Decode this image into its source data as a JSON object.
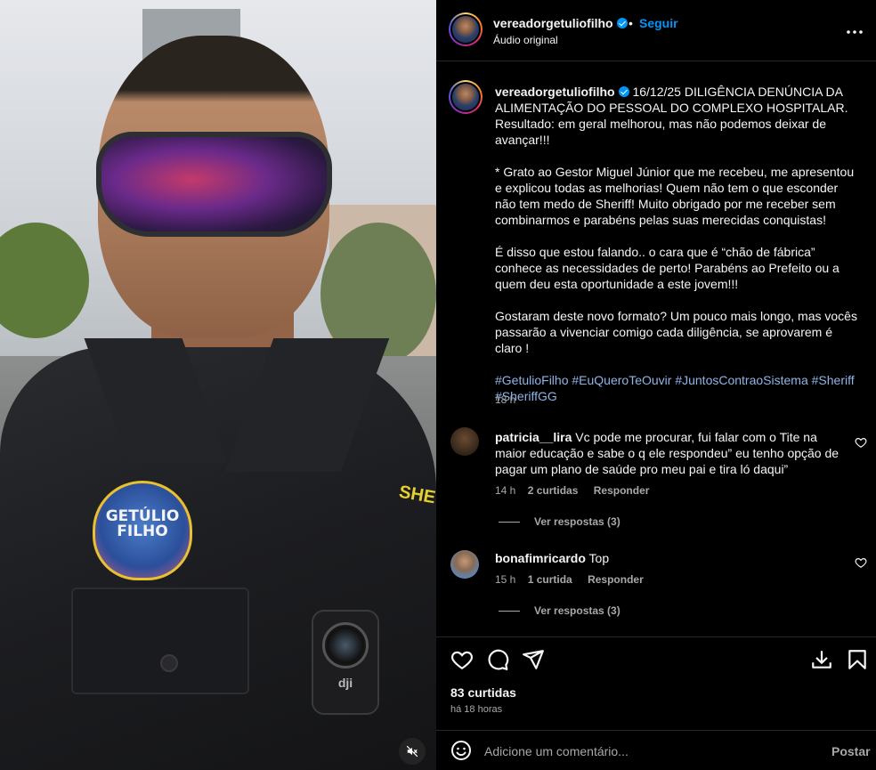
{
  "post": {
    "username": "vereadorgetuliofilho",
    "separator": "•",
    "follow_label": "Seguir",
    "audio_label": "Áudio original",
    "caption_username": "vereadorgetuliofilho",
    "caption_text": " 16/12/25 DILIGÊNCIA DENÚNCIA DA ALIMENTAÇÃO DO PESSOAL DO COMPLEXO HOSPITALAR.\nResultado: em geral melhorou, mas não podemos deixar de avançar!!!\n\n* Grato ao Gestor Miguel Júnior que me recebeu, me apresentou e explicou todas as melhorias! Quem não tem o que esconder não tem medo de Sheriff! Muito obrigado por me receber sem combinarmos e parabéns pelas suas merecidas conquistas!\n\nÉ disso que estou falando.. o cara que é “chão de fábrica” conhece as necessidades de perto! Parabéns ao Prefeito ou a quem deu esta oportunidade a este jovem!!!\n\nGostaram deste novo formato? Um pouco mais longo, mas vocês passarão a vivenciar comigo cada diligência, se aprovarem é claro !\n\n",
    "hashtags": "#GetulioFilho #EuQueroTeOuvir #JuntosContraoSistema #Sheriff #SheriffGG",
    "caption_time": "18 h",
    "likes": "83 curtidas",
    "time_ago": "há 18 horas"
  },
  "media": {
    "patch_text": "GETÚLIO FILHO",
    "shirt_text": "SHE",
    "camera_brand": "dji"
  },
  "comments": [
    {
      "username": "patricia__lira",
      "text": "Vc pode me procurar, fui falar com o Tite na maior educação e sabe o q ele respondeu” eu tenho opção de pagar um plano de saúde pro meu pai e tira ló daqui”",
      "time": "14 h",
      "likes": "2 curtidas",
      "reply": "Responder",
      "view_replies": "Ver respostas (3)"
    },
    {
      "username": "bonafimricardo",
      "text": "Top",
      "time": "15 h",
      "likes": "1 curtida",
      "reply": "Responder",
      "view_replies": "Ver respostas (3)"
    }
  ],
  "comment_box": {
    "placeholder": "Adicione um comentário...",
    "post_label": "Postar"
  },
  "icons": {
    "more": "more-options-icon",
    "like": "heart-icon",
    "comment": "comment-icon",
    "share": "share-icon",
    "download": "download-icon",
    "save": "bookmark-icon",
    "emoji": "emoji-icon",
    "mute": "mute-icon"
  },
  "colors": {
    "accent": "#0095f6",
    "background": "#000000",
    "text": "#f5f5f5",
    "muted": "#a8a8a8",
    "hashtag": "#8fb4e6"
  }
}
